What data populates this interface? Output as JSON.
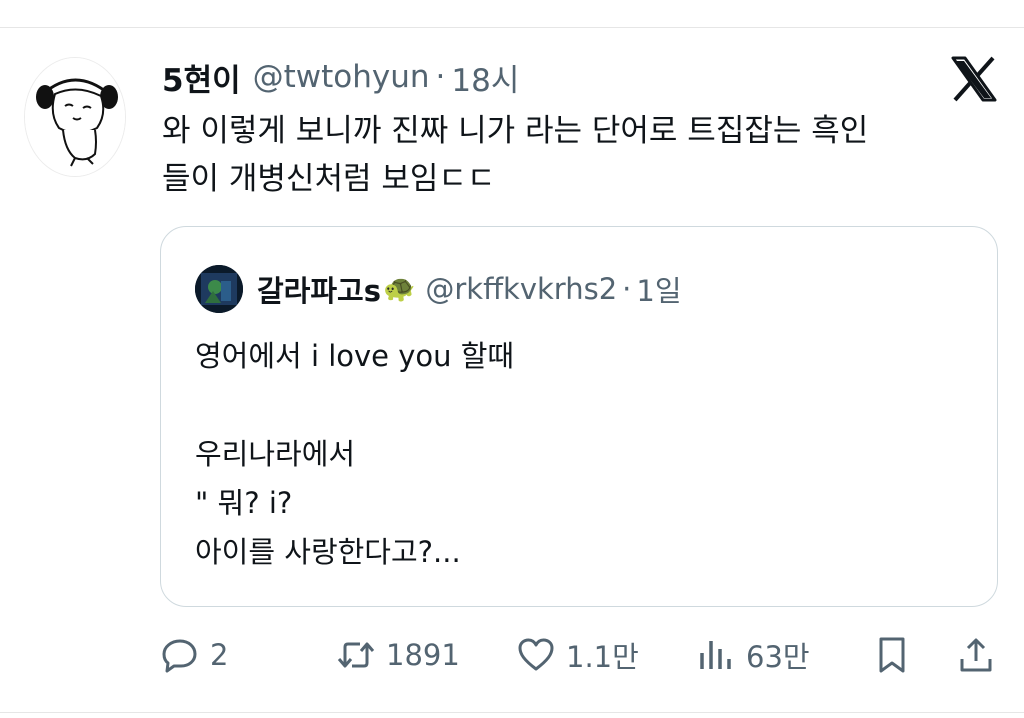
{
  "tweet": {
    "display_name": "5현이",
    "handle": "@twtohyun",
    "separator": "·",
    "time": "18시",
    "text": "와 이렇게 보니까 진짜 니가 라는 단어로 트집잡는 흑인\n들이 개병신처럼 보임ㄷㄷ"
  },
  "quoted_tweet": {
    "display_name": "갈라파고s",
    "emoji": "🐢",
    "handle": "@rkffkvkrhs2",
    "separator": "·",
    "time": "1일",
    "text": "영어에서 i love you 할때\n\n우리나라에서\n\" 뭐? i?\n아이를 사랑한다고?..."
  },
  "actions": {
    "replies": "2",
    "retweets": "1891",
    "likes": "1.1만",
    "views": "63만"
  },
  "icons": {
    "brand": "x-logo-icon",
    "reply": "reply-icon",
    "retweet": "retweet-icon",
    "like": "heart-icon",
    "views": "views-icon",
    "bookmark": "bookmark-icon",
    "share": "share-icon"
  },
  "colors": {
    "text_primary": "#0f1419",
    "text_secondary": "#536471",
    "border": "#cfd9de"
  }
}
